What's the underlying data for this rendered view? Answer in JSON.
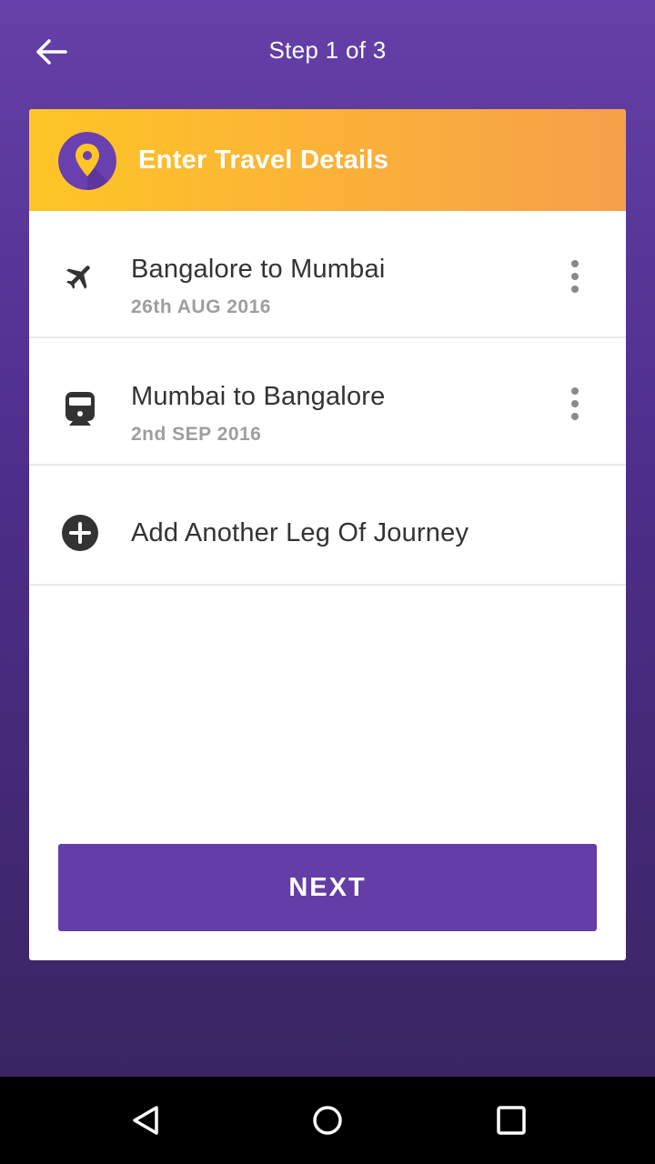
{
  "header": {
    "step_title": "Step 1 of 3",
    "back_icon": "arrow-left-icon"
  },
  "card": {
    "title": "Enter Travel Details",
    "title_icon": "location-pin-icon",
    "legs": [
      {
        "mode_icon": "airplane-icon",
        "route": "Bangalore to Mumbai",
        "date": "26th AUG 2016"
      },
      {
        "mode_icon": "train-icon",
        "route": "Mumbai to Bangalore",
        "date": "2nd SEP 2016"
      }
    ],
    "add_leg_label": "Add Another Leg Of Journey",
    "next_label": "NEXT"
  },
  "system_nav": {
    "back_icon": "triangle-back-icon",
    "home_icon": "circle-home-icon",
    "recents_icon": "square-recents-icon"
  },
  "colors": {
    "primary": "#643da6",
    "header_gradient_start": "#fdc625",
    "header_gradient_end": "#f6a04a",
    "text_primary": "#333333",
    "text_secondary": "#9e9e9e"
  }
}
